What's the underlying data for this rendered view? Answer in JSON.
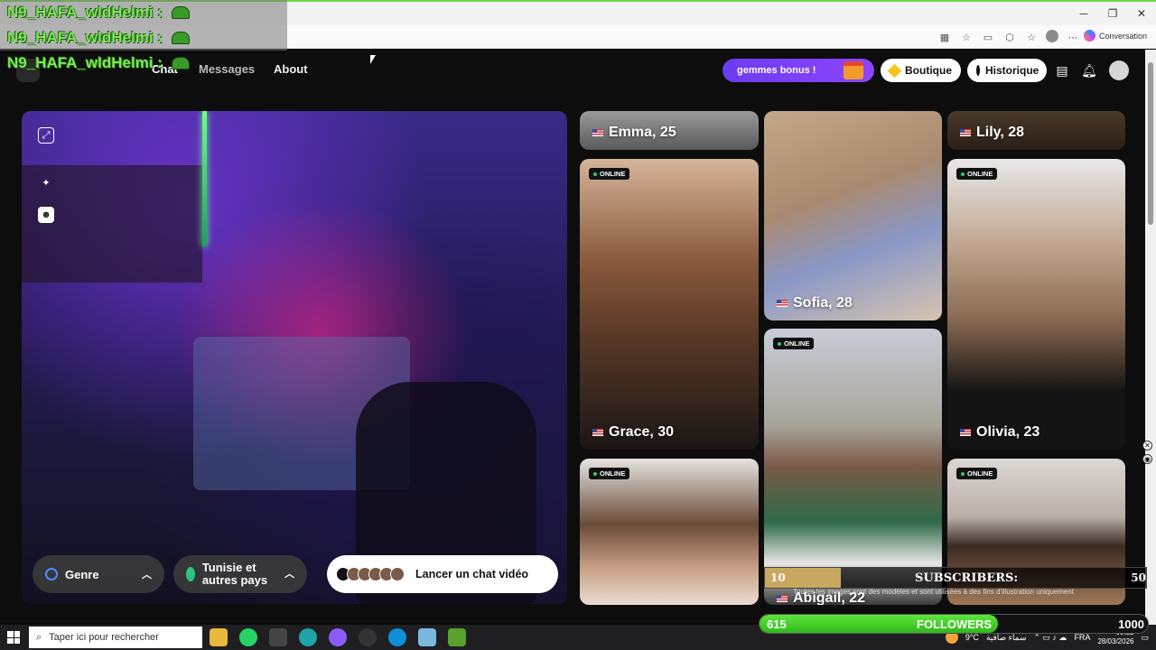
{
  "overlay": {
    "chat_lines": [
      "N9_HAFA_wldHelmi :",
      "N9_HAFA_wldHelmi :",
      "N9_HAFA_wldHelmi :"
    ]
  },
  "browser": {
    "conversation_label": "Conversation"
  },
  "nav": {
    "chat": "Chat",
    "messages": "Messages",
    "about": "About",
    "gems_bonus": "gemmes bonus !",
    "boutique": "Boutique",
    "historique": "Historique"
  },
  "video_panel": {
    "genre_label": "Genre",
    "country_label": "Tunisie et autres pays",
    "launch_label": "Lancer un chat vidéo"
  },
  "profiles": [
    {
      "name": "Emma, 25",
      "online": false
    },
    {
      "name": "Sofia, 28",
      "online": false
    },
    {
      "name": "Lily, 28",
      "online": false
    },
    {
      "name": "Grace, 30",
      "online": true
    },
    {
      "name": "Olivia, 23",
      "online": true
    },
    {
      "name": "Abigail, 22",
      "online": true
    },
    {
      "name": "",
      "online": true
    },
    {
      "name": "",
      "online": true
    }
  ],
  "online_label": "ONLINE",
  "disclaimer": "Toutes les images sont des modèles et sont utilisées à des fins d'illustration uniquement",
  "subscribers": {
    "label": "SUBSCRIBERS:",
    "current": "10",
    "goal": "50",
    "progress": 0.2
  },
  "followers": {
    "label": "FOLLOWERS",
    "current": "615",
    "goal": "1000",
    "progress": 0.615
  },
  "taskbar": {
    "search_placeholder": "Taper ici pour rechercher",
    "weather": "9°C",
    "weather_text": "سماء صافية",
    "language": "FRA",
    "time": "00:22",
    "date": "28/03/2026"
  }
}
